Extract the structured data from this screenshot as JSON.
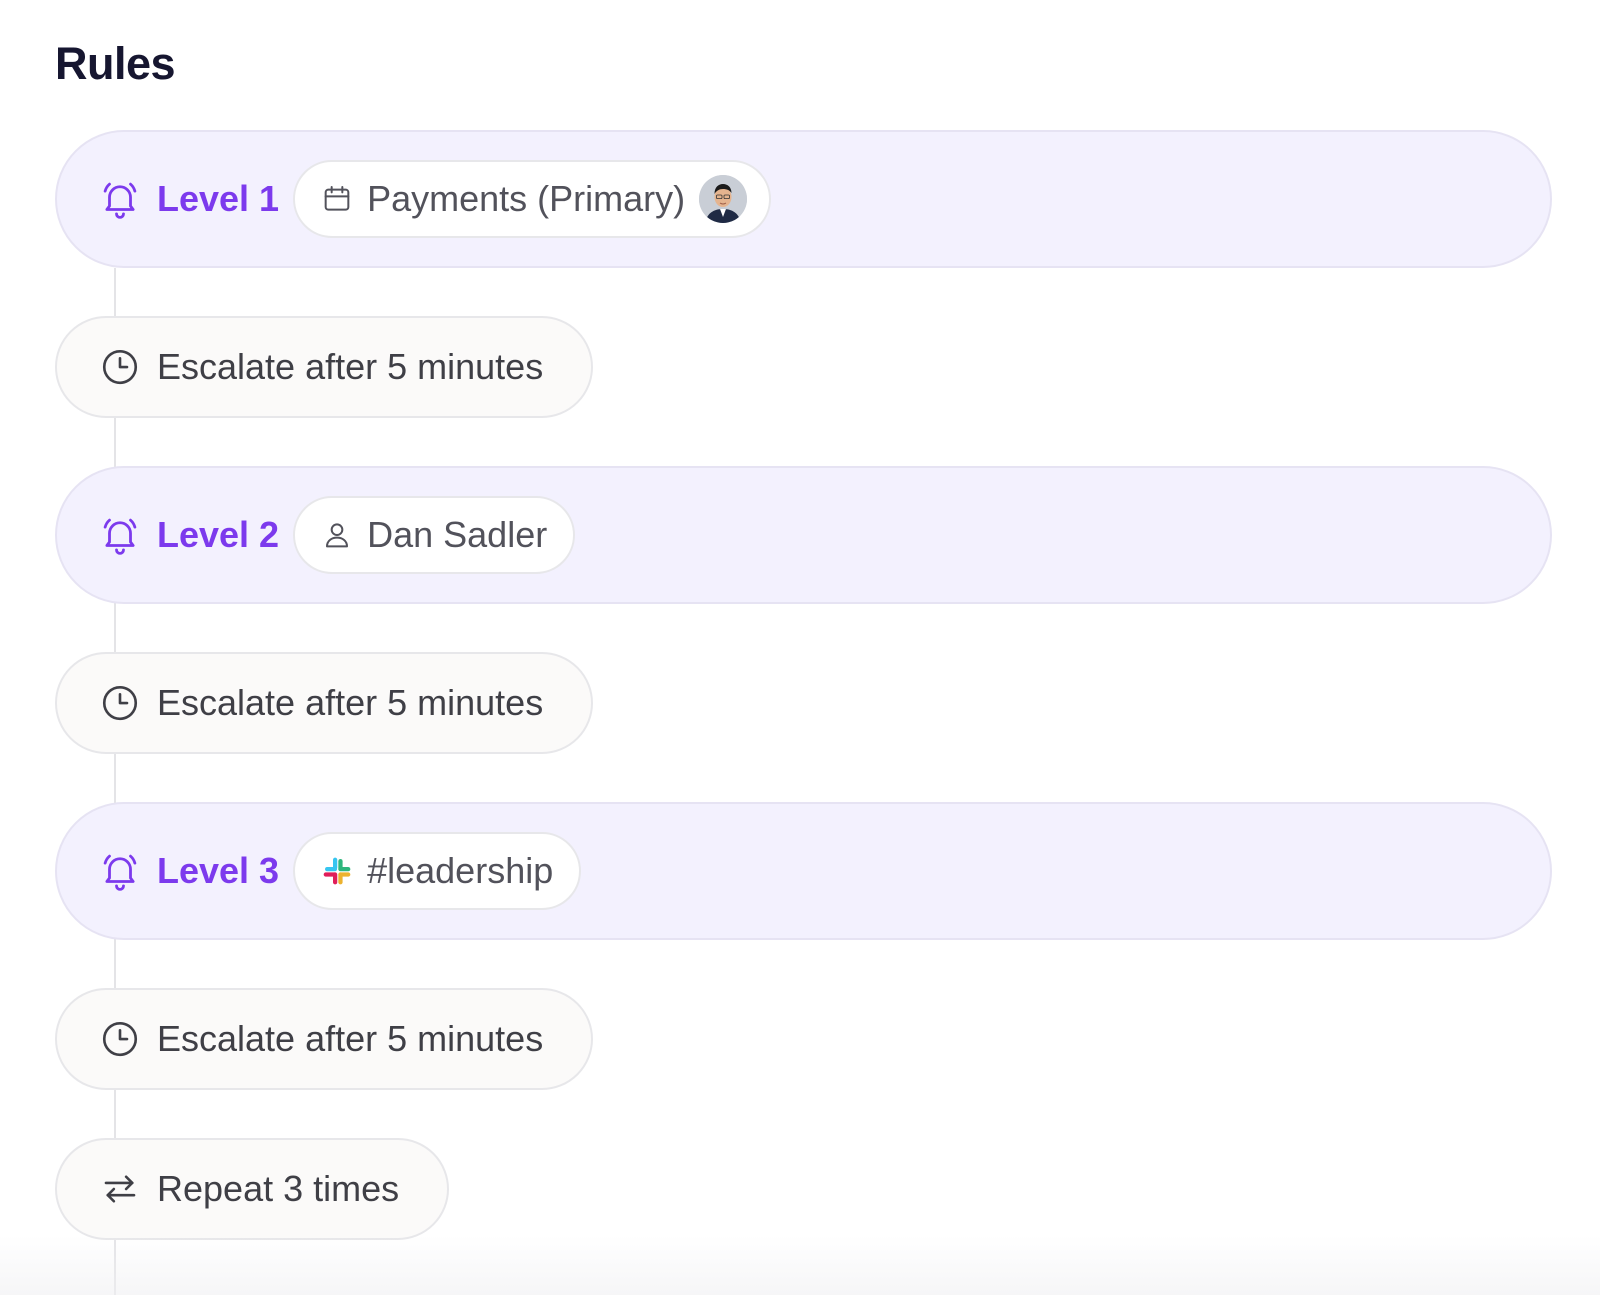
{
  "page": {
    "title": "Rules"
  },
  "colors": {
    "accent": "#7c3aed",
    "level_bg": "#f3f1fe",
    "step_bg": "#fbfaf9"
  },
  "levels": [
    {
      "label": "Level 1",
      "target": {
        "type": "schedule",
        "icon": "calendar-icon",
        "name": "Payments (Primary)",
        "has_avatar": true
      }
    },
    {
      "label": "Level 2",
      "target": {
        "type": "user",
        "icon": "user-icon",
        "name": "Dan Sadler"
      }
    },
    {
      "label": "Level 3",
      "target": {
        "type": "slack-channel",
        "icon": "slack-icon",
        "name": "#leadership"
      }
    }
  ],
  "steps": [
    {
      "icon": "clock-icon",
      "label": "Escalate after 5 minutes"
    },
    {
      "icon": "clock-icon",
      "label": "Escalate after 5 minutes"
    },
    {
      "icon": "clock-icon",
      "label": "Escalate after 5 minutes"
    },
    {
      "icon": "repeat-icon",
      "label": "Repeat 3 times"
    }
  ]
}
